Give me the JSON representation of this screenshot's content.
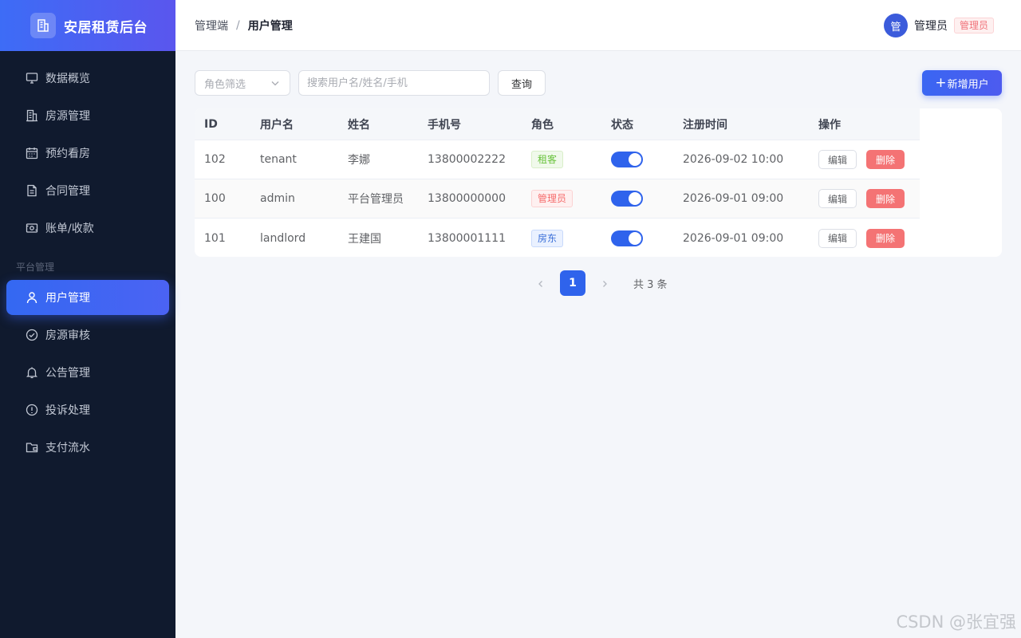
{
  "brand": {
    "title": "安居租赁后台"
  },
  "sidebar": {
    "items": [
      {
        "label": "数据概览",
        "icon": "monitor-icon"
      },
      {
        "label": "房源管理",
        "icon": "building-icon"
      },
      {
        "label": "预约看房",
        "icon": "calendar-icon"
      },
      {
        "label": "合同管理",
        "icon": "document-icon"
      },
      {
        "label": "账单/收款",
        "icon": "wallet-icon"
      }
    ],
    "group_label": "平台管理",
    "group_items": [
      {
        "label": "用户管理",
        "icon": "user-icon",
        "active": true
      },
      {
        "label": "房源审核",
        "icon": "check-circle-icon"
      },
      {
        "label": "公告管理",
        "icon": "bell-icon"
      },
      {
        "label": "投诉处理",
        "icon": "alert-circle-icon"
      },
      {
        "label": "支付流水",
        "icon": "folder-icon"
      }
    ]
  },
  "header": {
    "breadcrumb": {
      "parent": "管理端",
      "separator": "/",
      "current": "用户管理"
    },
    "user": {
      "avatar_text": "管",
      "name": "管理员",
      "role_tag": "管理员"
    }
  },
  "toolbar": {
    "role_filter_placeholder": "角色筛选",
    "search_placeholder": "搜索用户名/姓名/手机",
    "query_label": "查询",
    "add_label": "新增用户",
    "add_icon": "+"
  },
  "table": {
    "columns": [
      "ID",
      "用户名",
      "姓名",
      "手机号",
      "角色",
      "状态",
      "注册时间",
      "操作"
    ],
    "rows": [
      {
        "id": "102",
        "username": "tenant",
        "name": "李娜",
        "phone": "13800002222",
        "role": "租客",
        "role_color": "green",
        "enabled": true,
        "registered": "2026-09-02 10:00",
        "edit": "编辑",
        "delete": "删除"
      },
      {
        "id": "100",
        "username": "admin",
        "name": "平台管理员",
        "phone": "13800000000",
        "role": "管理员",
        "role_color": "red",
        "enabled": true,
        "registered": "2026-09-01 09:00",
        "edit": "编辑",
        "delete": "删除"
      },
      {
        "id": "101",
        "username": "landlord",
        "name": "王建国",
        "phone": "13800001111",
        "role": "房东",
        "role_color": "blue",
        "enabled": true,
        "registered": "2026-09-01 09:00",
        "edit": "编辑",
        "delete": "删除"
      }
    ]
  },
  "pagination": {
    "current_page": "1",
    "total_text": "共 3 条"
  },
  "watermark": "CSDN @张宜强",
  "colors": {
    "primary": "#2f63ec",
    "sidebar_bg": "#101a2e",
    "danger": "#f47374"
  }
}
